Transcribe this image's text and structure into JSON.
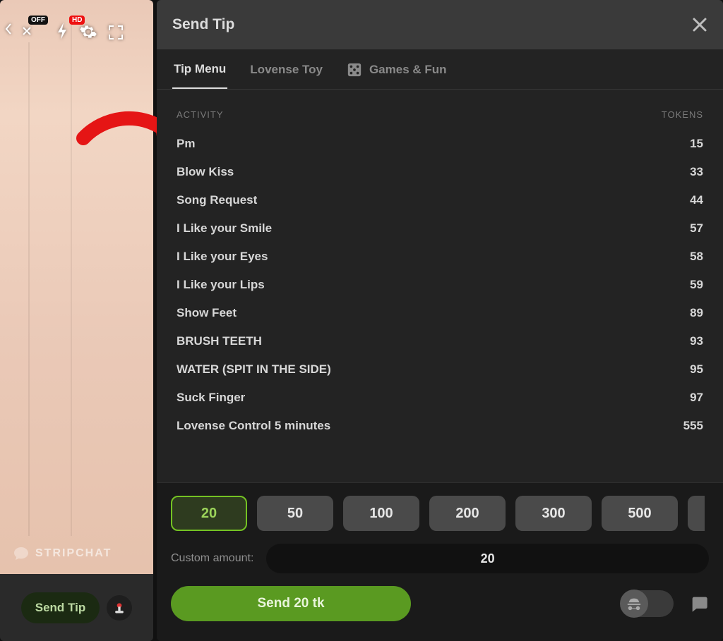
{
  "stream": {
    "badges": {
      "off": "OFF",
      "hd": "HD"
    },
    "brand": "STRIPCHAT",
    "send_tip_label": "Send Tip"
  },
  "modal": {
    "title": "Send Tip",
    "tabs": [
      {
        "label": "Tip Menu",
        "active": true
      },
      {
        "label": "Lovense Toy",
        "active": false
      },
      {
        "label": "Games & Fun",
        "active": false
      }
    ],
    "headers": {
      "activity": "ACTIVITY",
      "tokens": "TOKENS"
    },
    "menu": [
      {
        "activity": "Pm",
        "tokens": 15
      },
      {
        "activity": "Blow Kiss",
        "tokens": 33
      },
      {
        "activity": "Song Request",
        "tokens": 44
      },
      {
        "activity": "I Like your Smile",
        "tokens": 57
      },
      {
        "activity": "I Like your Eyes",
        "tokens": 58
      },
      {
        "activity": "I Like your Lips",
        "tokens": 59
      },
      {
        "activity": "Show Feet",
        "tokens": 89
      },
      {
        "activity": "BRUSH TEETH",
        "tokens": 93
      },
      {
        "activity": "WATER (SPIT IN THE SIDE)",
        "tokens": 95
      },
      {
        "activity": "Suck Finger",
        "tokens": 97
      },
      {
        "activity": "Lovense Control 5 minutes",
        "tokens": 555
      }
    ],
    "amounts": [
      {
        "value": 20,
        "selected": true
      },
      {
        "value": 50,
        "selected": false
      },
      {
        "value": 100,
        "selected": false
      },
      {
        "value": 200,
        "selected": false
      },
      {
        "value": 300,
        "selected": false
      },
      {
        "value": 500,
        "selected": false
      }
    ],
    "custom_label": "Custom amount:",
    "custom_value": "20",
    "send_label": "Send 20 tk"
  }
}
